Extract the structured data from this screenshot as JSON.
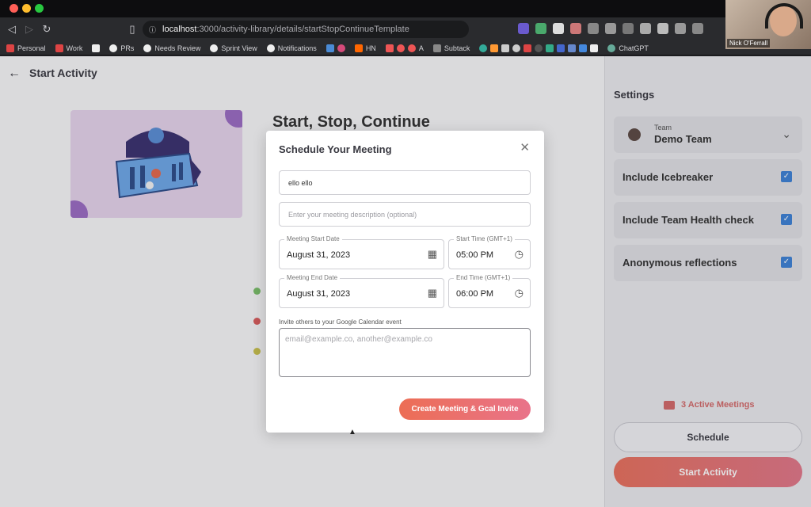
{
  "browser": {
    "url_host": "localhost",
    "url_path": ":3000/activity-library/details/startStopContinueTemplate",
    "bookmarks": [
      "Personal",
      "Work",
      "PRs",
      "Needs Review",
      "Sprint View",
      "Notifications",
      "HN",
      "A",
      "Subtack",
      "ChatGPT"
    ],
    "video_name": "Nick O'Ferrall"
  },
  "header": {
    "title": "Start Activity"
  },
  "activity": {
    "title": "Start, Stop, Continue"
  },
  "settings": {
    "title": "Settings",
    "team_label": "Team",
    "team_name": "Demo Team",
    "options": [
      {
        "label": "Include Icebreaker",
        "checked": true
      },
      {
        "label": "Include Team Health check",
        "checked": true
      },
      {
        "label": "Anonymous reflections",
        "checked": true
      }
    ],
    "active_meetings": "3 Active Meetings",
    "schedule_label": "Schedule",
    "start_label": "Start Activity"
  },
  "modal": {
    "title": "Schedule Your Meeting",
    "name_value": "ello ello",
    "description_placeholder": "Enter your meeting description (optional)",
    "start_date_label": "Meeting Start Date",
    "start_date": "August 31, 2023",
    "start_time_label": "Start Time (GMT+1)",
    "start_time": "05:00 PM",
    "end_date_label": "Meeting End Date",
    "end_date": "August 31, 2023",
    "end_time_label": "End Time (GMT+1)",
    "end_time": "06:00 PM",
    "invite_label": "Invite others to your Google Calendar event",
    "invite_placeholder": "email@example.co, another@example.co",
    "submit_label": "Create Meeting & Gcal Invite"
  },
  "colors": {
    "accent": "#e8715e",
    "check": "#3e82d6",
    "dot_green": "#7bbf6a",
    "dot_red": "#d95c5c",
    "dot_yellow": "#c9c24e"
  }
}
